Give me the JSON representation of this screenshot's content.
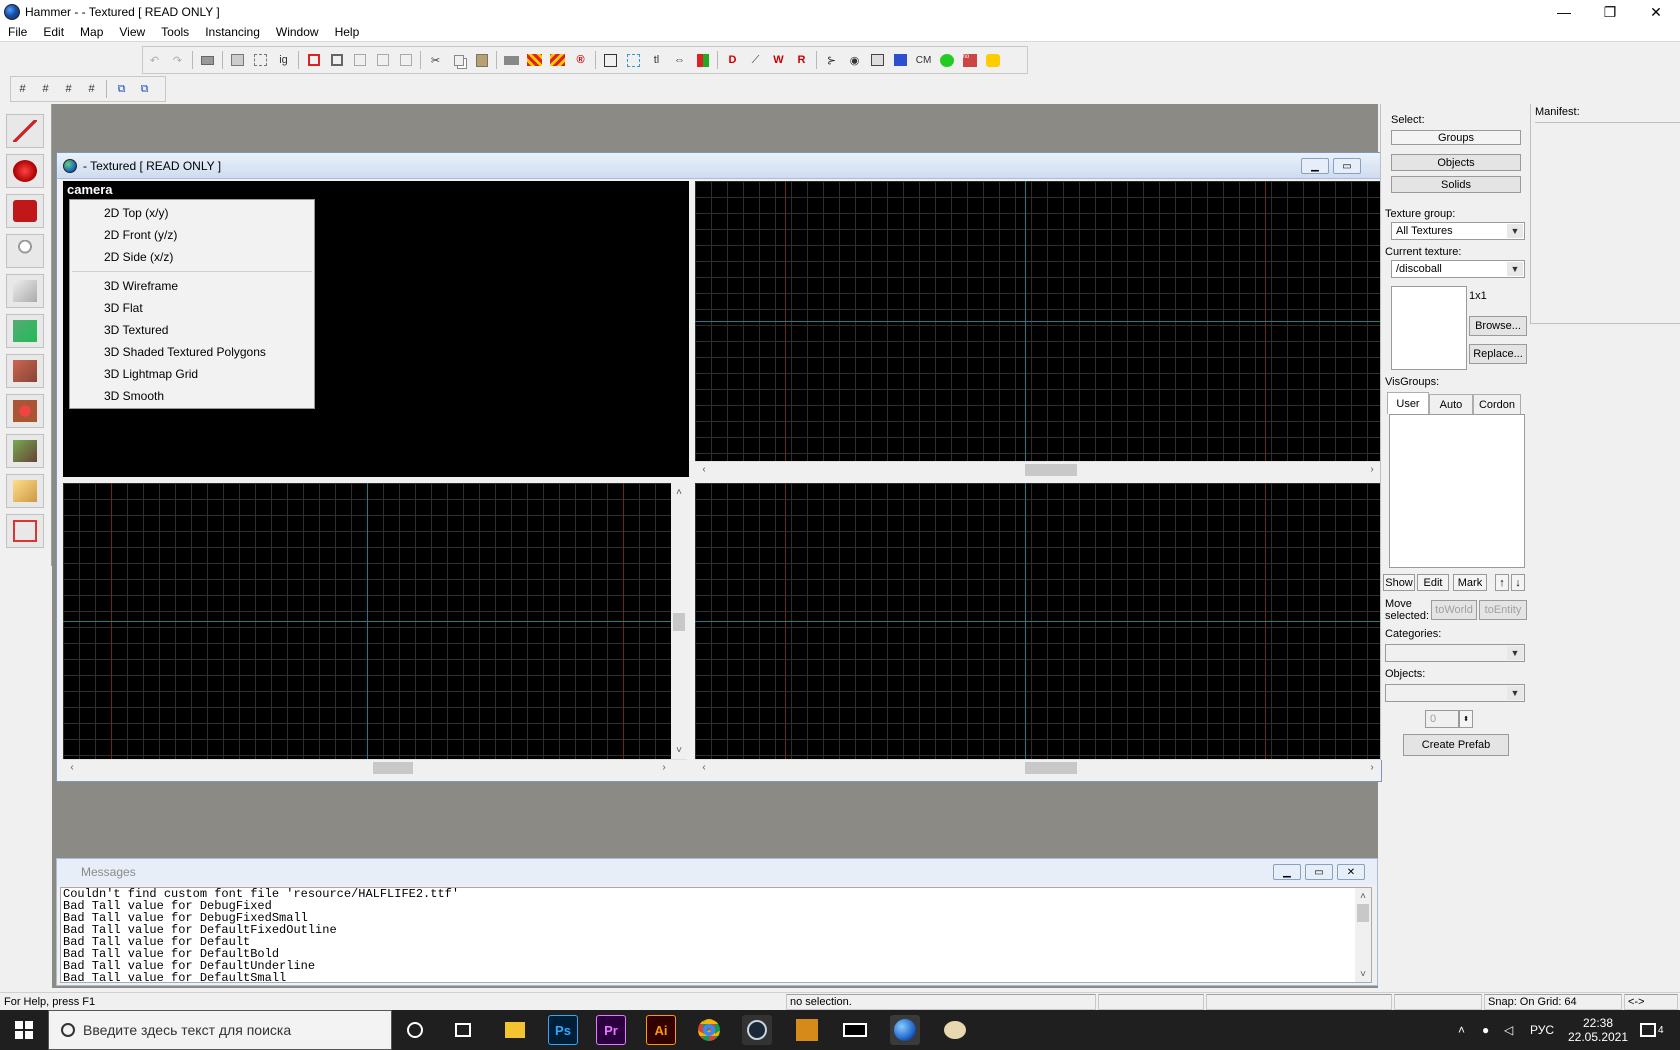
{
  "window": {
    "title": "Hammer -  - Textured [ READ ONLY ]",
    "minimize": "—",
    "restore": "❐",
    "close": "✕"
  },
  "menu": [
    "File",
    "Edit",
    "Map",
    "View",
    "Tools",
    "Instancing",
    "Window",
    "Help"
  ],
  "toolbar_icons": {
    "undo": "↶",
    "redo": "↷",
    "ig": "ig",
    "tl": "tl",
    "cm": "CM"
  },
  "document": {
    "title": "- Textured [ READ ONLY ]",
    "camera_label": "camera",
    "context_menu": {
      "group1": [
        "2D Top (x/y)",
        "2D Front (y/z)",
        "2D Side (x/z)"
      ],
      "group2": [
        "3D Wireframe",
        "3D Flat",
        "3D Textured",
        "3D Shaded Textured Polygons",
        "3D Lightmap Grid",
        "3D Smooth"
      ]
    }
  },
  "right_panel": {
    "select_label": "Select:",
    "select_buttons": [
      "Groups",
      "Objects",
      "Solids"
    ],
    "texture_group_label": "Texture group:",
    "texture_group_value": "All Textures",
    "current_texture_label": "Current texture:",
    "current_texture_value": "/discoball",
    "texture_size": "1x1",
    "browse": "Browse...",
    "replace": "Replace...",
    "visgroups_label": "VisGroups:",
    "visgroup_tabs": [
      "User",
      "Auto",
      "Cordon"
    ],
    "visgroup_buttons": [
      "Show",
      "Edit",
      "Mark"
    ],
    "move_selected_label": [
      "Move",
      "selected:"
    ],
    "to_world": "toWorld",
    "to_entity": "toEntity",
    "categories_label": "Categories:",
    "objects_label": "Objects:",
    "spinner_value": "0",
    "create_prefab": "Create Prefab"
  },
  "manifest": {
    "label": "Manifest:"
  },
  "messages": {
    "title": "Messages",
    "lines": [
      "Couldn't find custom font file 'resource/HALFLIFE2.ttf'",
      "Bad Tall value for DebugFixed",
      "Bad Tall value for DebugFixedSmall",
      "Bad Tall value for DefaultFixedOutline",
      "Bad Tall value for Default",
      "Bad Tall value for DefaultBold",
      "Bad Tall value for DefaultUnderline",
      "Bad Tall value for DefaultSmall"
    ]
  },
  "status": {
    "help": "For Help, press F1",
    "selection": "no selection.",
    "snap": "Snap: On Grid: 64",
    "arrows": "<->"
  },
  "taskbar": {
    "search_placeholder": "Введите здесь текст для поиска",
    "lang": "РУС",
    "time": "22:38",
    "date": "22.05.2021",
    "notif_count": "4",
    "apps": {
      "ps": "Ps",
      "pr": "Pr",
      "ai": "Ai"
    }
  },
  "colors": {
    "viewport_bg": "#000000",
    "grid_line": "#2e2e2e",
    "axis_line": "#1e7c86",
    "mdi_bg": "#8c8a85",
    "taskbar_bg": "#1f1f1f"
  }
}
